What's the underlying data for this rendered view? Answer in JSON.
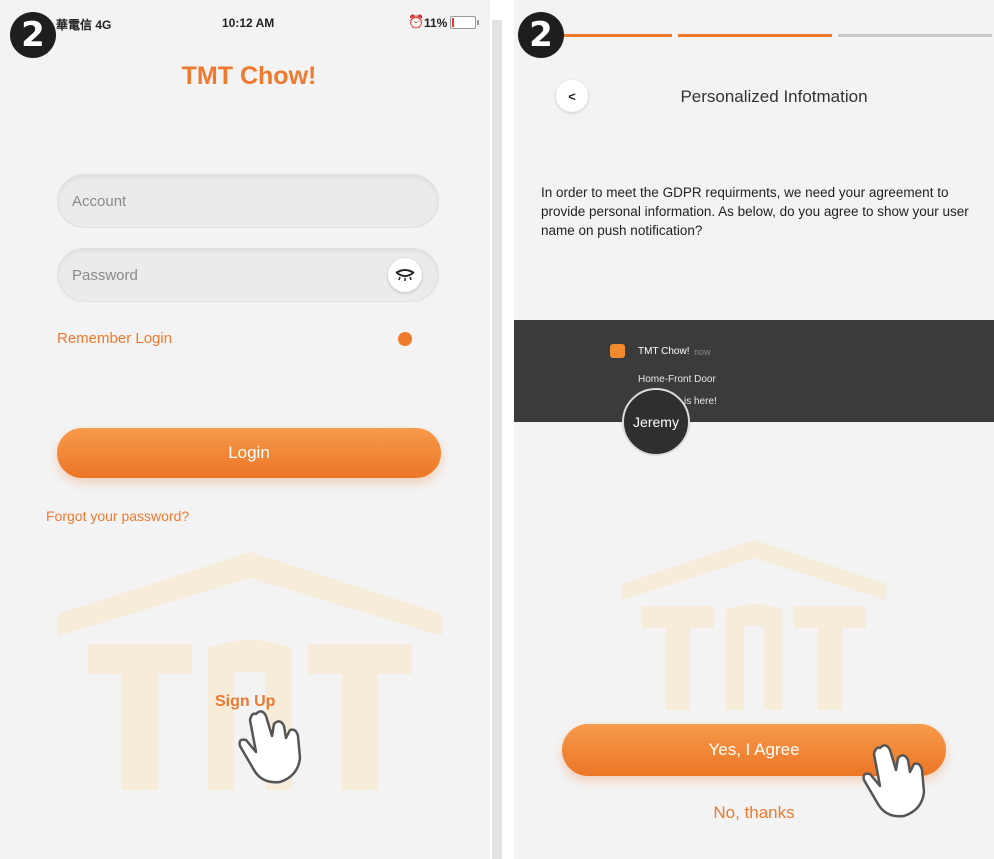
{
  "left_screen": {
    "step_number": "2",
    "status_bar": {
      "carrier": "華電信  4G",
      "time": "10:12 AM",
      "battery": "11%"
    },
    "app_title": "TMT Chow!",
    "account": {
      "placeholder": "Account",
      "value": ""
    },
    "password": {
      "placeholder": "Password",
      "value": ""
    },
    "remember_login": {
      "label": "Remember Login",
      "on": true
    },
    "login_label": "Login",
    "forgot_label": "Forgot your password?",
    "sign_up_label": "Sign Up",
    "icons": [
      "eye-closed-icon",
      "tap-hand-icon",
      "tmt-logo-watermark"
    ]
  },
  "right_screen": {
    "step_number": "2",
    "progress": {
      "steps_total": 3,
      "steps_done": 2
    },
    "back_label": "<",
    "title": "Personalized Infotmation",
    "body_text": "In order to meet the GDPR requirments, we need your agreement to provide personal information. As below, do you agree to show your user name on push notification?",
    "notification": {
      "app_name": "TMT Chow!",
      "time": "now",
      "line1": "Home-Front Door",
      "line2": "is here!",
      "user_name": "Jeremy"
    },
    "agree_label": "Yes, I Agree",
    "decline_label": "No, thanks"
  },
  "colors": {
    "accent": "#ee7a2f",
    "progress_inactive": "#c9c9c9",
    "background": "#f3f3f3",
    "notification_bg": "#3b3b3b"
  }
}
